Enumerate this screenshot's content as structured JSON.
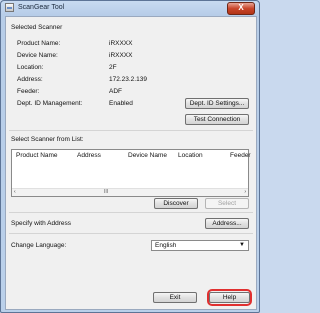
{
  "window": {
    "title": "ScanGear Tool",
    "close_symbol": "X"
  },
  "selected_scanner": {
    "heading": "Selected Scanner",
    "fields": [
      {
        "label": "Product Name:",
        "value": "iRXXXX"
      },
      {
        "label": "Device Name:",
        "value": "iRXXXX"
      },
      {
        "label": "Location:",
        "value": "2F"
      },
      {
        "label": "Address:",
        "value": "172.23.2.139"
      },
      {
        "label": "Feeder:",
        "value": "ADF"
      },
      {
        "label": "Dept. ID Management:",
        "value": "Enabled"
      }
    ],
    "dept_id_settings_label": "Dept. ID Settings...",
    "test_connection_label": "Test Connection"
  },
  "scanner_list": {
    "heading": "Select Scanner from List:",
    "columns": [
      "Product Name",
      "Address",
      "Device Name",
      "Location",
      "Feeder"
    ],
    "scroll_left": "‹",
    "scroll_grip": "III",
    "scroll_right": "›",
    "discover_label": "Discover",
    "select_label": "Select"
  },
  "specify": {
    "label": "Specify with Address",
    "address_button_label": "Address..."
  },
  "language": {
    "label": "Change Language:",
    "selected": "English",
    "caret": "▼"
  },
  "footer": {
    "exit_label": "Exit",
    "help_label": "Help"
  },
  "colors": {
    "highlight": "#e03030",
    "title_close": "#c9452a"
  }
}
